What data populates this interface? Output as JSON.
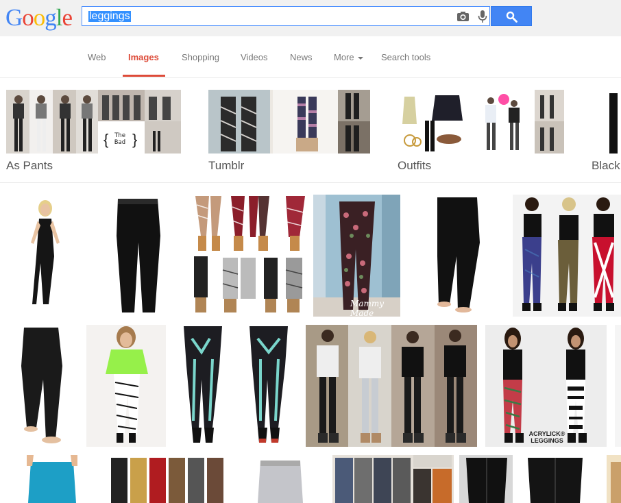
{
  "header": {
    "logo_letters": [
      {
        "ch": "G",
        "color": "#4285f4"
      },
      {
        "ch": "o",
        "color": "#ea4335"
      },
      {
        "ch": "o",
        "color": "#fbbc05"
      },
      {
        "ch": "g",
        "color": "#4285f4"
      },
      {
        "ch": "l",
        "color": "#34a853"
      },
      {
        "ch": "e",
        "color": "#ea4335"
      }
    ],
    "search_query": "leggings",
    "search_icon": "magnifier-icon",
    "camera_icon": "camera-icon",
    "mic_icon": "microphone-icon"
  },
  "nav": {
    "tabs": [
      {
        "label": "Web",
        "active": false
      },
      {
        "label": "Images",
        "active": true
      },
      {
        "label": "Shopping",
        "active": false
      },
      {
        "label": "Videos",
        "active": false
      },
      {
        "label": "News",
        "active": false
      },
      {
        "label": "More",
        "active": false,
        "dropdown": true
      },
      {
        "label": "Search tools",
        "active": false
      }
    ],
    "accent_color": "#dd4b39"
  },
  "related": [
    {
      "label": "As Pants"
    },
    {
      "label": "Tumblr"
    },
    {
      "label": "Outfits"
    },
    {
      "label": "Black"
    }
  ],
  "collage_text": {
    "the_bad": "The\nBad"
  },
  "results": {
    "watermark_mammy": "Mammy Made",
    "brand_acrylick": "ACRYLICK®",
    "brand_leggings": "LEGGINGS"
  },
  "colors": {
    "search_blue": "#4285f4",
    "highlight": "#3390ff",
    "header_bg": "#f1f1f1"
  }
}
